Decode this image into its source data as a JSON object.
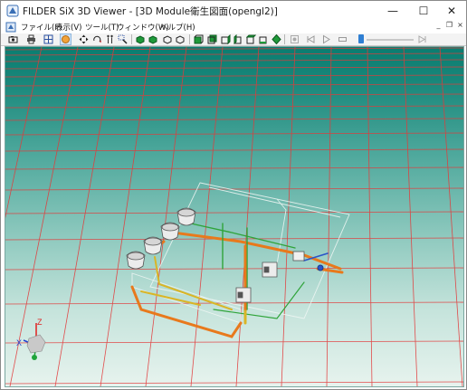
{
  "window": {
    "title": "FILDER SiX 3D Viewer - [3D Module衛生図面(opengl2)]",
    "controls": {
      "minimize": "—",
      "maximize": "☐",
      "close": "✕"
    }
  },
  "menu": {
    "items": [
      "ファイル(F)",
      "表示(V)",
      "ツール(T)",
      "ウィンドウ(W)",
      "ヘルプ(H)"
    ],
    "mdi_controls": {
      "minimize": "_",
      "restore": "❐",
      "close": "×"
    }
  },
  "toolbar": {
    "tools": [
      "camera-icon",
      "print-icon",
      "grid-view-icon",
      "shade-icon",
      "pan-icon",
      "rotate-icon",
      "walk-icon",
      "zoom-window-icon",
      "view-iso-1-icon",
      "view-iso-2-icon",
      "view-iso-3-icon",
      "view-iso-4-icon",
      "view-front-icon",
      "view-back-icon",
      "view-left-icon",
      "view-right-icon",
      "view-top-icon",
      "view-bottom-icon",
      "view-diamond-icon",
      "record-icon",
      "skip-back-icon",
      "play-icon",
      "stop-icon",
      "skip-forward-icon"
    ],
    "active_tool": "shade-icon",
    "animation_position": 0.05
  },
  "viewport": {
    "background_top": "#0a7d70",
    "background_bottom": "#e7f3ee",
    "grid_color": "#e23b3b",
    "axes": {
      "x_label": "X",
      "z_label": "Z"
    },
    "pipe_colors": {
      "orange": "#e8791c",
      "yellow": "#d9b526",
      "green": "#2fa43a",
      "blue": "#2a55c9"
    }
  }
}
